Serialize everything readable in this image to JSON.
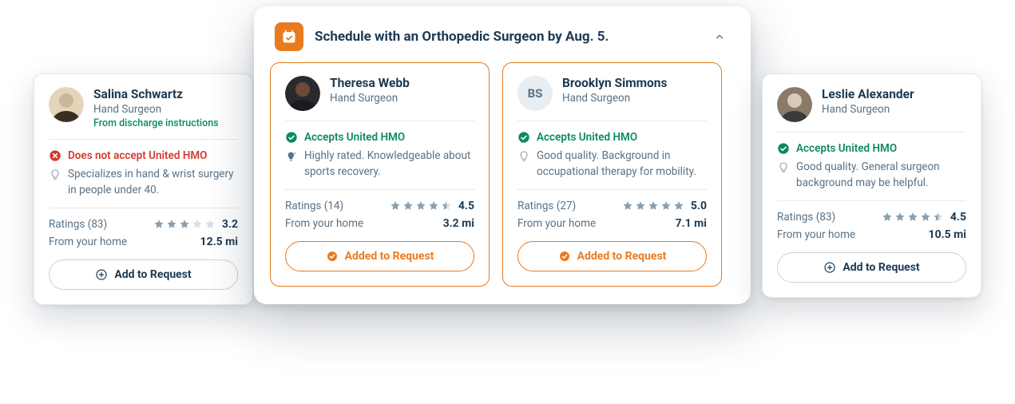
{
  "panel": {
    "title": "Schedule with an Orthopedic Surgeon by Aug. 5."
  },
  "labels": {
    "ratings_prefix": "Ratings",
    "distance_label": "From your home",
    "add_button": "Add to Request",
    "added_button": "Added to Request"
  },
  "providers": [
    {
      "name": "Salina Schwartz",
      "role": "Hand Surgeon",
      "source": "From discharge instructions",
      "avatar": "photo1",
      "initials": "",
      "accepts": false,
      "insurance_text": "Does not accept United HMO",
      "desc_icon": "bulb",
      "desc": "Specializes in hand & wrist surgery in people under 40.",
      "rating_count": 83,
      "stars": 3,
      "score": "3.2",
      "distance": "12.5 mi",
      "added": false
    },
    {
      "name": "Theresa Webb",
      "role": "Hand Surgeon",
      "source": "",
      "avatar": "photo2",
      "initials": "",
      "accepts": true,
      "insurance_text": "Accepts United HMO",
      "desc_icon": "sparkle",
      "desc": "Highly rated. Knowledgeable about sports recovery.",
      "rating_count": 14,
      "stars": 4.5,
      "score": "4.5",
      "distance": "3.2 mi",
      "added": true
    },
    {
      "name": "Brooklyn Simmons",
      "role": "Hand Surgeon",
      "source": "",
      "avatar": "",
      "initials": "BS",
      "accepts": true,
      "insurance_text": "Accepts United HMO",
      "desc_icon": "bulb",
      "desc": "Good quality. Background in occupational therapy for mobility.",
      "rating_count": 27,
      "stars": 5,
      "score": "5.0",
      "distance": "7.1 mi",
      "added": true
    },
    {
      "name": "Leslie Alexander",
      "role": "Hand Surgeon",
      "source": "",
      "avatar": "photo3",
      "initials": "",
      "accepts": true,
      "insurance_text": "Accepts United HMO",
      "desc_icon": "bulb",
      "desc": "Good quality. General surgeon background may be helpful.",
      "rating_count": 83,
      "stars": 4.5,
      "score": "4.5",
      "distance": "10.5 mi",
      "added": false
    }
  ]
}
